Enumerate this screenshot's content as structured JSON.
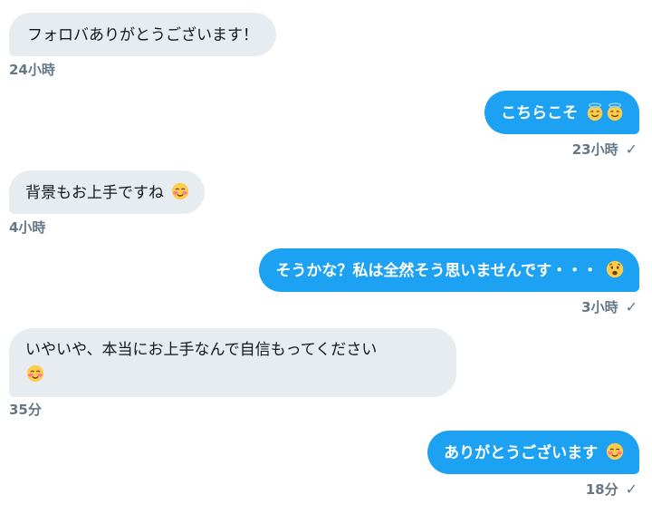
{
  "conversation": {
    "messages": [
      {
        "direction": "incoming",
        "text": "フォロバありがとうございます！",
        "emojis": [],
        "time": "24小時"
      },
      {
        "direction": "outgoing",
        "text": "こちらこそ",
        "emojis": [
          "smiling-face-with-halo",
          "smiling-face-with-halo"
        ],
        "time": "23小時",
        "status": "✓"
      },
      {
        "direction": "incoming",
        "text": "背景もお上手ですね",
        "emojis": [
          "smiling-face-with-blush"
        ],
        "time": "4小時"
      },
      {
        "direction": "outgoing",
        "text": "そうかな？私は全然そう思いませんです・・・",
        "emojis": [
          "anguished-face"
        ],
        "time": "3小時",
        "status": "✓"
      },
      {
        "direction": "incoming",
        "text": "いやいや、本当にお上手なんで自信もってください",
        "emojis": [
          "smiling-face-with-blush"
        ],
        "time": "35分"
      },
      {
        "direction": "outgoing",
        "text": "ありがとうございます",
        "emojis": [
          "smiling-face-with-blush"
        ],
        "time": "18分",
        "status": "✓"
      }
    ]
  },
  "colors": {
    "incoming_bubble": "#e6ecf0",
    "outgoing_bubble": "#1da1f2",
    "meta_text": "#657786"
  }
}
